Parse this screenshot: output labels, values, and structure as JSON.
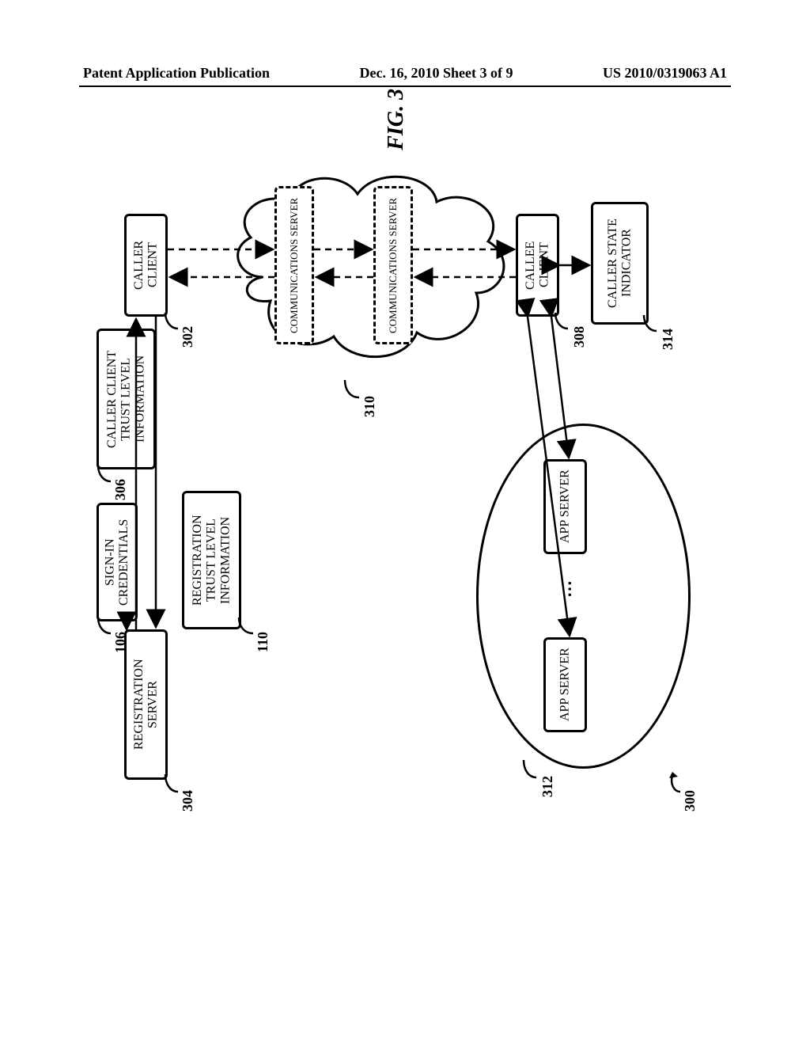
{
  "header": {
    "left": "Patent Application Publication",
    "center": "Dec. 16, 2010  Sheet 3 of 9",
    "right": "US 2010/0319063 A1"
  },
  "figure": {
    "label": "FIG. 3",
    "system_ref": "300",
    "registration_server": {
      "label": "REGISTRATION SERVER",
      "ref": "304"
    },
    "signin_credentials": {
      "label": "SIGN-IN CREDENTIALS",
      "ref": "106"
    },
    "caller_trust": {
      "label": "CALLER CLIENT TRUST LEVEL INFORMATION",
      "ref": "306"
    },
    "reg_trust": {
      "label": "REGISTRATION TRUST LEVEL INFORMATION",
      "ref": "110"
    },
    "caller_client": {
      "label": "CALLER CLIENT",
      "ref": "302"
    },
    "cloud_ref": "310",
    "comm_server1": "COMMUNICATIONS SERVER",
    "comm_server2": "COMMUNICATIONS SERVER",
    "callee_client": {
      "label": "CALLEE CLIENT",
      "ref": "308"
    },
    "caller_state": {
      "label": "CALLER STATE INDICATOR",
      "ref": "314"
    },
    "appserver_group_ref": "312",
    "app_server1": "APP SERVER",
    "app_server2": "APP SERVER",
    "ellipsis": "⋯"
  }
}
